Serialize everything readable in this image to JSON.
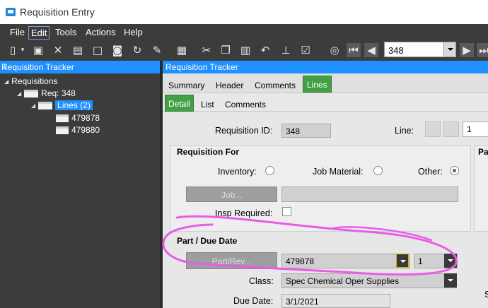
{
  "window": {
    "title": "Requisition Entry"
  },
  "menu": {
    "file": "File",
    "edit": "Edit",
    "tools": "Tools",
    "actions": "Actions",
    "help": "Help"
  },
  "toolbar": {
    "record_value": "348"
  },
  "left_panel": {
    "header": "Requisition Tracker",
    "tree": {
      "root": "Requisitions",
      "req": "Req: 348",
      "lines": "Lines (2)",
      "line1": "479878",
      "line2": "479880"
    }
  },
  "right_panel": {
    "header": "Requisition Tracker",
    "tabs": [
      "Summary",
      "Header",
      "Comments",
      "Lines"
    ],
    "subtabs": [
      "Detail",
      "List",
      "Comments"
    ]
  },
  "form": {
    "requisition_id_label": "Requisition ID:",
    "requisition_id": "348",
    "line_label": "Line:",
    "line_value": "1",
    "requisition_for_title": "Requisition For",
    "inventory_label": "Inventory:",
    "job_material_label": "Job Material:",
    "other_label": "Other:",
    "job_button": "Job...",
    "insp_required_label": "Insp Required:",
    "part_due_title": "Part / Due Date",
    "partrev_button": "Part/Rev...",
    "part_value": "479878",
    "rev_value": "1",
    "class_label": "Class:",
    "class_value": "Spec Chemical Oper Supplies",
    "due_date_label": "Due Date:",
    "due_date_value": "3/1/2021",
    "right_clip_label": "Pa",
    "right_clip_label2": "S"
  },
  "annotation_color": "#e85ce8",
  "accent_color": "#1e90ff",
  "tab_active_color": "#43a047"
}
